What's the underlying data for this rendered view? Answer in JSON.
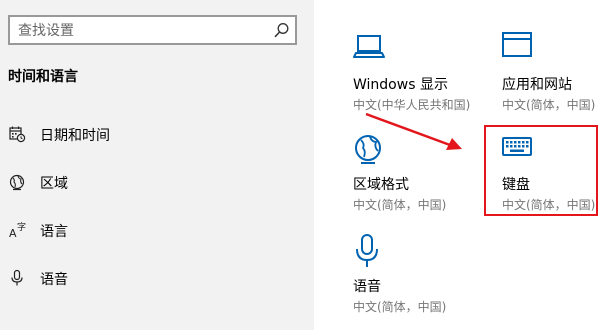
{
  "search": {
    "placeholder": "查找设置"
  },
  "nav": {
    "section_title": "时间和语言",
    "items": [
      {
        "label": "日期和时间",
        "icon": "calendar-clock-icon"
      },
      {
        "label": "区域",
        "icon": "globe-region-icon"
      },
      {
        "label": "语言",
        "icon": "language-icon"
      },
      {
        "label": "语音",
        "icon": "microphone-icon"
      }
    ]
  },
  "tiles": [
    {
      "title": "Windows 显示",
      "subtitle": "中文(中华人民共和国)",
      "icon": "laptop-icon"
    },
    {
      "title": "应用和网站",
      "subtitle": "中文(简体，中国)",
      "icon": "window-icon"
    },
    {
      "title": "区域格式",
      "subtitle": "中文(简体，中国)",
      "icon": "globe-edit-icon"
    },
    {
      "title": "键盘",
      "subtitle": "中文(简体，中国)",
      "icon": "keyboard-icon"
    },
    {
      "title": "语音",
      "subtitle": "中文(简体，中国)",
      "icon": "microphone-icon"
    }
  ],
  "colors": {
    "accent": "#0063b1",
    "sidebar_bg": "#f2f2f2",
    "annotation_red": "#e3161b"
  }
}
